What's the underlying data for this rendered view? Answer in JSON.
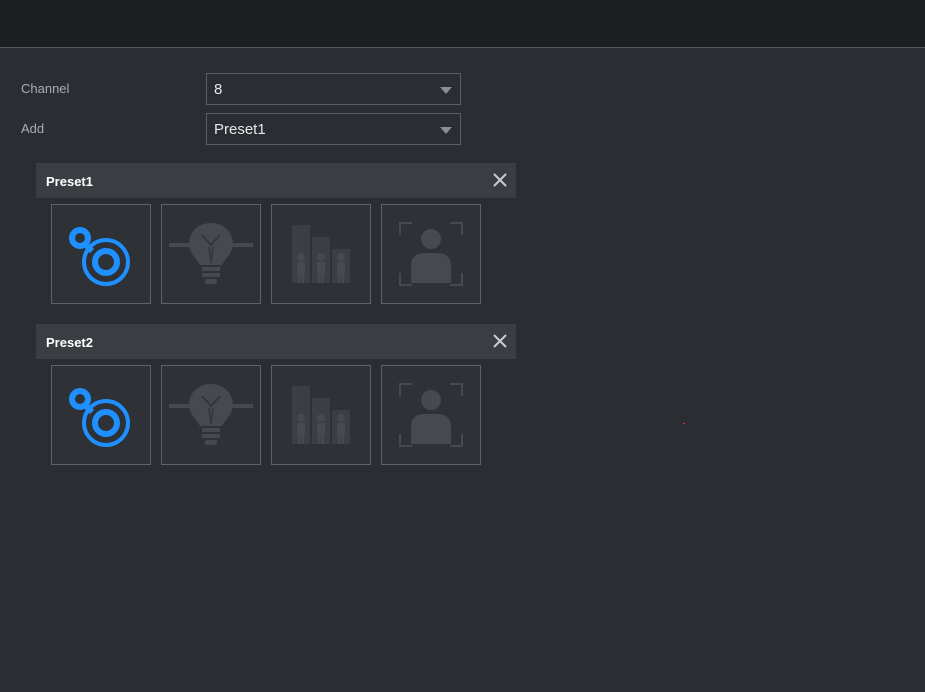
{
  "form": {
    "channel": {
      "label": "Channel",
      "value": "8"
    },
    "add": {
      "label": "Add",
      "value": "Preset1"
    }
  },
  "presets": [
    {
      "title": "Preset1",
      "tiles": [
        {
          "icon": "ivs-tripwire-icon",
          "active": true
        },
        {
          "icon": "light-bulb-icon",
          "active": false
        },
        {
          "icon": "crowd-people-icon",
          "active": false
        },
        {
          "icon": "face-detection-icon",
          "active": false
        }
      ]
    },
    {
      "title": "Preset2",
      "tiles": [
        {
          "icon": "ivs-tripwire-icon",
          "active": true
        },
        {
          "icon": "light-bulb-icon",
          "active": false
        },
        {
          "icon": "crowd-people-icon",
          "active": false
        },
        {
          "icon": "face-detection-icon",
          "active": false
        }
      ]
    }
  ],
  "colors": {
    "active_icon": "#1e90ff",
    "inactive_icon": "#46494e",
    "background": "#2a2d32",
    "header": "#3a3d42"
  }
}
